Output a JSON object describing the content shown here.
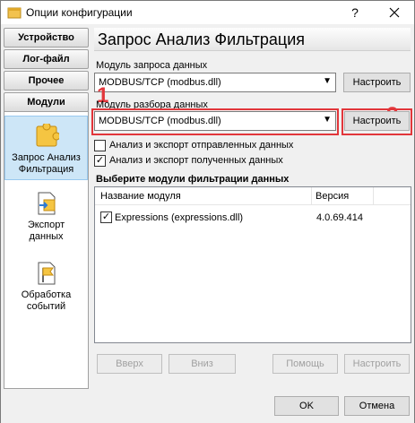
{
  "window": {
    "title": "Опции конфигурации"
  },
  "nav_buttons": [
    "Устройство",
    "Лог-файл",
    "Прочее",
    "Модули"
  ],
  "nav_items": [
    {
      "label_line1": "Запрос Анализ",
      "label_line2": "Фильтрация",
      "icon": "puzzle-icon"
    },
    {
      "label_line1": "Экспорт",
      "label_line2": "данных",
      "icon": "export-icon"
    },
    {
      "label_line1": "Обработка",
      "label_line2": "событий",
      "icon": "flag-icon"
    }
  ],
  "main": {
    "heading": "Запрос Анализ Фильтрация",
    "query_label": "Модуль запроса данных",
    "query_value": "MODBUS/TCP (modbus.dll)",
    "query_button": "Настроить",
    "parse_label": "Модуль разбора данных",
    "parse_value": "MODBUS/TCP (modbus.dll)",
    "parse_button": "Настроить",
    "check_sent": "Анализ и экспорт отправленных данных",
    "check_received": "Анализ и экспорт полученных данных",
    "filter_heading": "Выберите модули фильтрации данных",
    "col_name": "Название модуля",
    "col_version": "Версия",
    "rows": [
      {
        "name": "Expressions (expressions.dll)",
        "version": "4.0.69.414",
        "checked": true
      }
    ],
    "btn_up": "Вверх",
    "btn_down": "Вниз",
    "btn_help": "Помощь",
    "btn_config": "Настроить"
  },
  "footer": {
    "ok": "OK",
    "cancel": "Отмена"
  },
  "annotations": {
    "one": "1",
    "two": "2"
  },
  "colors": {
    "accent_red": "#e2363b",
    "selection": "#cde6f7"
  }
}
